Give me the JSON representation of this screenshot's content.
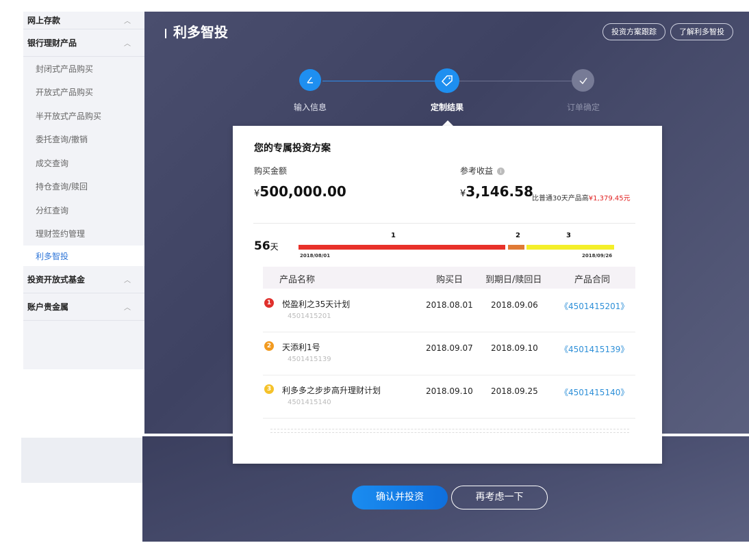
{
  "sidebar": {
    "groups": [
      {
        "label": "网上存款",
        "chevron": "︿"
      },
      {
        "label": "银行理财产品",
        "chevron": "︿"
      },
      {
        "label": "投资开放式基金",
        "chevron": "︿"
      },
      {
        "label": "账户贵金属",
        "chevron": "︿"
      }
    ],
    "items": [
      {
        "label": "封闭式产品购买"
      },
      {
        "label": "开放式产品购买"
      },
      {
        "label": "半开放式产品购买"
      },
      {
        "label": "委托查询/撤销"
      },
      {
        "label": "成交查询"
      },
      {
        "label": "持仓查询/赎回"
      },
      {
        "label": "分红查询"
      },
      {
        "label": "理财签约管理"
      },
      {
        "label": "利多智投",
        "active": true
      }
    ]
  },
  "header": {
    "title": "利多智投",
    "btn_track": "投资方案跟踪",
    "btn_learn": "了解利多智投"
  },
  "steps": [
    {
      "label": "输入信息",
      "icon": "pencil-icon",
      "state": "done"
    },
    {
      "label": "定制结果",
      "icon": "tag-icon",
      "state": "active"
    },
    {
      "label": "订单确定",
      "icon": "check-icon",
      "state": "pending"
    }
  ],
  "card": {
    "title": "您的专属投资方案",
    "amount_label": "购买金额",
    "amount_currency": "¥",
    "amount_value": "500,000.00",
    "yield_label": "参考收益",
    "yield_currency": "¥",
    "yield_value": "3,146.58",
    "compare_prefix": "比普通30天产品高",
    "compare_value": "¥1,379.45",
    "compare_suffix": "元"
  },
  "timeline": {
    "days": "56",
    "days_unit": "天",
    "start_date": "2018/08/01",
    "end_date": "2018/09/26",
    "segments": [
      {
        "num": "1",
        "color": "#e8312a"
      },
      {
        "num": "2",
        "color": "#e07a35"
      },
      {
        "num": "3",
        "color": "#f4ef2a"
      }
    ]
  },
  "table": {
    "headers": [
      "产品名称",
      "购买日",
      "到期日/赎回日",
      "产品合同"
    ],
    "rows": [
      {
        "no": "1",
        "color": "#e0302c",
        "name": "悦盈利之35天计划",
        "code": "4501415201",
        "buy": "2018.08.01",
        "due": "2018.09.06",
        "contract": "《4501415201》"
      },
      {
        "no": "2",
        "color": "#f29a1f",
        "name": "天添利1号",
        "code": "4501415139",
        "buy": "2018.09.07",
        "due": "2018.09.10",
        "contract": "《4501415139》"
      },
      {
        "no": "3",
        "color": "#f5c22a",
        "name": "利多多之步步高升理财计划",
        "code": "4501415140",
        "buy": "2018.09.10",
        "due": "2018.09.25",
        "contract": "《4501415140》"
      }
    ]
  },
  "actions": {
    "confirm": "确认并投资",
    "rethink": "再考虑一下"
  }
}
